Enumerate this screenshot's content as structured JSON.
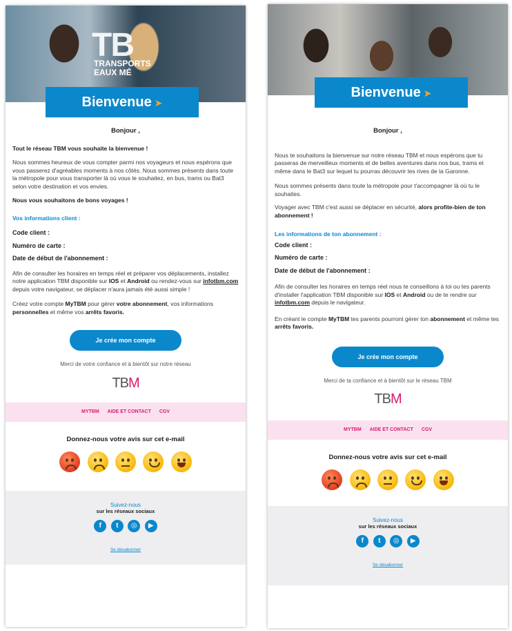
{
  "left": {
    "hero_logo": "TB",
    "hero_logo_sub": "TRANSPORTS\nEAUX MÉ",
    "banner": "Bienvenue",
    "greeting": "Bonjour ,",
    "intro_bold": "Tout le réseau TBM vous souhaite la bienvenue !",
    "paragraph1": "Nous sommes heureux de vous compter parmi nos voyageurs et nous espérons que vous passerez d'agréables moments à nos côtés. Nous sommes présents dans toute la métropole pour vous transporter là où vous le souhaitez, en bus, trams ou Bat3 selon votre destination et vos envies.",
    "wish": "Nous vous souhaitons de bons voyages !",
    "info_title": "Vos informations client :",
    "field_client": "Code client :",
    "field_card": "Numéro de carte :",
    "field_date": "Date de début de l'abonnement :",
    "hours_p1": "Afin de consulter les horaires en temps réel et préparer vos déplacements, installez notre application TBM disponible sur ",
    "ios": "IOS",
    "et": " et ",
    "android": "Android",
    "hours_p2": " ou rendez-vous sur ",
    "site": "infotbm.com",
    "hours_p3": " depuis votre navigateur, se déplacer n'aura jamais été aussi simple !",
    "mytbm_p1": "Créez votre compte ",
    "mytbm": "MyTBM",
    "mytbm_p2": " pour gérer ",
    "mytbm_b1": "votre abonnement",
    "mytbm_p3": ", vos informations ",
    "mytbm_b2": "personnelles",
    "mytbm_p4": " et même vos ",
    "mytbm_b3": "arrêts favoris.",
    "cta": "Je crée mon compte",
    "thanks": "Merci de votre confiance et à bientôt sur notre réseau",
    "links": [
      "MYTBM",
      "AIDE ET CONTACT",
      "CGV"
    ],
    "feedback": "Donnez-nous votre avis sur cet e-mail",
    "follow": "Suivez-nous",
    "networks": "sur les réseaux sociaux",
    "unsubscribe": "Se désabonner"
  },
  "right": {
    "banner": "Bienvenue",
    "greeting": "Bonjour ,",
    "paragraph1": "Nous te souhaitons la bienvenue sur notre réseau TBM et nous espérons que tu passeras de merveilleux moments et de belles aventures dans nos bus, trams et même dans le Bat3 sur lequel tu pourras découvrir les rives de la Garonne.",
    "paragraph2": "Nous sommes présents dans toute la métropole pour t'accompagner là où tu le souhaites.",
    "paragraph3": "Voyager avec TBM c'est aussi se déplacer en sécurité, ",
    "paragraph3_bold": "alors profite-bien de ton abonnement !",
    "info_title": "Les informations de ton abonnement :",
    "field_client": "Code client :",
    "field_card": "Numéro de carte :",
    "field_date": "Date de début de l'abonnement :",
    "hours_p1": "Afin de consulter les horaires en temps réel nous te conseillons à toi ou tes parents d'installer l'application TBM disponible sur ",
    "ios": "IOS",
    "et": " et ",
    "android": "Android",
    "hours_p2": " ou de te rendre sur ",
    "site": "infotbm.com",
    "hours_p3": " depuis le navigateur.",
    "mytbm_p1": "En créant le compte ",
    "mytbm": "MyTBM",
    "mytbm_p2": " tes parents pourront gérer ton ",
    "mytbm_b1": "abonnement",
    "mytbm_p3": " et même tes ",
    "mytbm_b3": "arrêts favoris.",
    "cta": "Je crée mon compte",
    "thanks": "Merci de ta confiance et à bientôt sur le réseau TBM",
    "links": [
      "MYTBM",
      "AIDE ET CONTACT",
      "CGV"
    ],
    "feedback": "Donnez-nous votre avis sur cet e-mail",
    "follow": "Suivez-nous",
    "networks": "sur les réseaux sociaux",
    "unsubscribe": "Se désabonner"
  },
  "brand": {
    "logo": "TBM",
    "logo_accent": "M",
    "primary": "#0b88cc",
    "accent": "#d71a72",
    "links_bg": "#fbe1ef"
  },
  "emojis": [
    "angry-face-icon",
    "frowning-face-icon",
    "neutral-face-icon",
    "smiling-face-icon",
    "grinning-face-icon"
  ],
  "social": [
    "facebook-icon",
    "twitter-icon",
    "instagram-icon",
    "youtube-icon"
  ]
}
